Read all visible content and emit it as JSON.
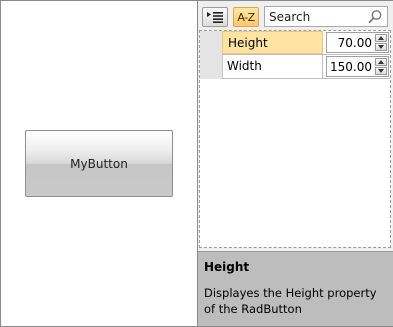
{
  "button": {
    "label": "MyButton"
  },
  "toolbar": {
    "categorize_icon": "categorized-list-icon",
    "sort_label": "A-Z",
    "search_value": "Search",
    "search_icon": "magnifier-icon"
  },
  "properties": [
    {
      "name": "Height",
      "value": "70.00",
      "selected": true
    },
    {
      "name": "Width",
      "value": "150.00",
      "selected": false
    }
  ],
  "description": {
    "title": "Height",
    "text": "Displayes the Height property of the RadButton"
  },
  "colors": {
    "selection": "#ffe3a3",
    "sort_active": "#ffc86b",
    "description_bg": "#bdbdbd"
  }
}
